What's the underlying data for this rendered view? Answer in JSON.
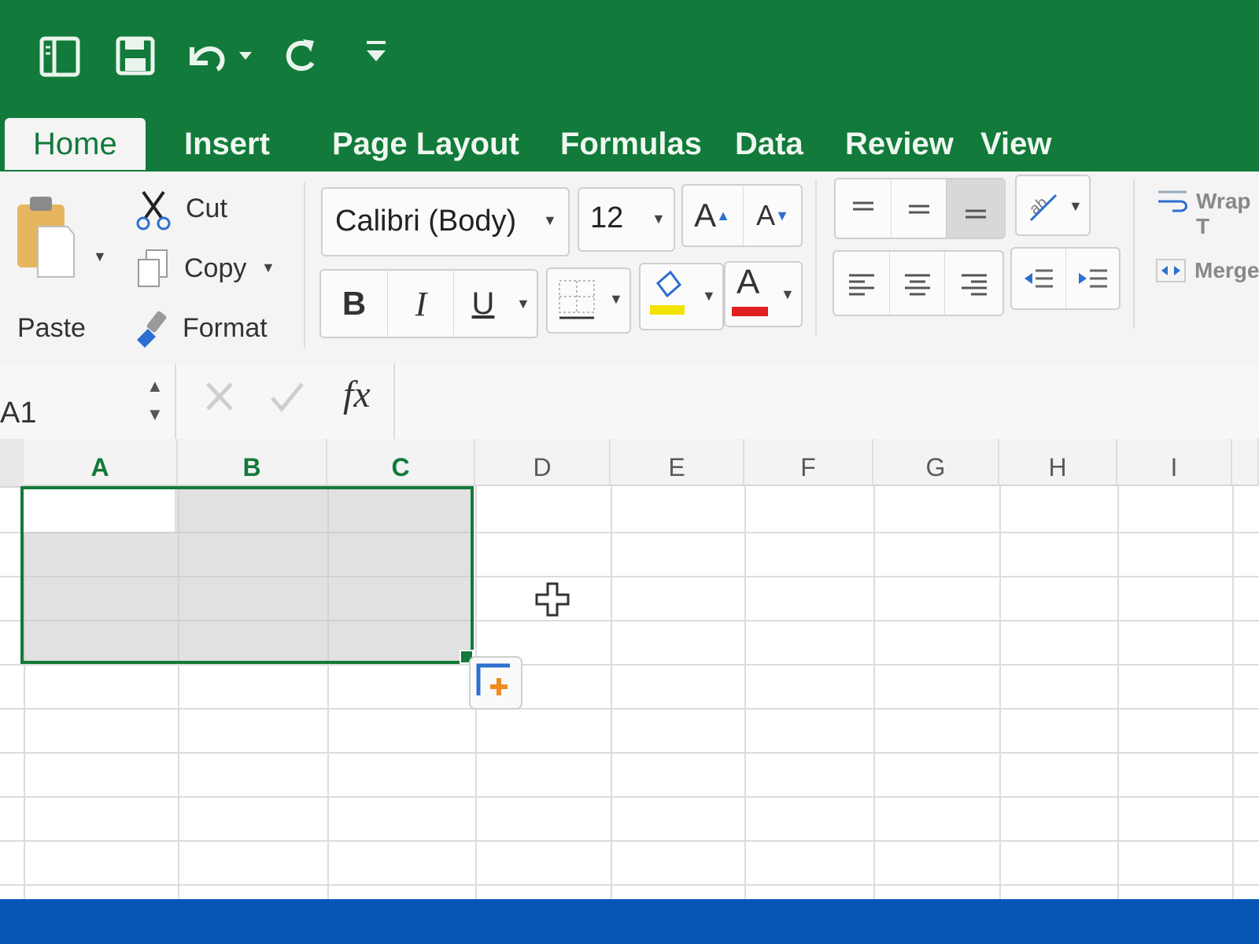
{
  "colors": {
    "brand_green": "#127a3a",
    "footer_blue": "#0756b5",
    "highlight_yellow": "#f2e200",
    "font_red": "#e02020"
  },
  "quick_access": {
    "items": [
      {
        "name": "sidebar-toggle-icon"
      },
      {
        "name": "save-icon"
      },
      {
        "name": "undo-icon"
      },
      {
        "name": "redo-icon"
      },
      {
        "name": "customize-toolbar-icon"
      }
    ]
  },
  "tabs": [
    {
      "label": "Home",
      "active": true
    },
    {
      "label": "Insert"
    },
    {
      "label": "Page Layout"
    },
    {
      "label": "Formulas"
    },
    {
      "label": "Data"
    },
    {
      "label": "Review"
    },
    {
      "label": "View"
    }
  ],
  "clipboard": {
    "paste_label": "Paste",
    "cut_label": "Cut",
    "copy_label": "Copy",
    "format_label": "Format"
  },
  "font": {
    "family_value": "Calibri (Body)",
    "size_value": "12",
    "increase_icon": "A",
    "decrease_icon": "A",
    "bold_label": "B",
    "italic_label": "I",
    "underline_label": "U",
    "font_color_letter": "A"
  },
  "alignment": {
    "wrap_label": "Wrap T",
    "merge_label": "Merge"
  },
  "formula_bar": {
    "name_box_value": "A1",
    "fx_label": "fx",
    "formula_value": ""
  },
  "sheet": {
    "columns": [
      "A",
      "B",
      "C",
      "D",
      "E",
      "F",
      "G",
      "H",
      "I"
    ],
    "selected_columns": [
      "A",
      "B",
      "C"
    ],
    "selection_range": "A1:C4"
  }
}
